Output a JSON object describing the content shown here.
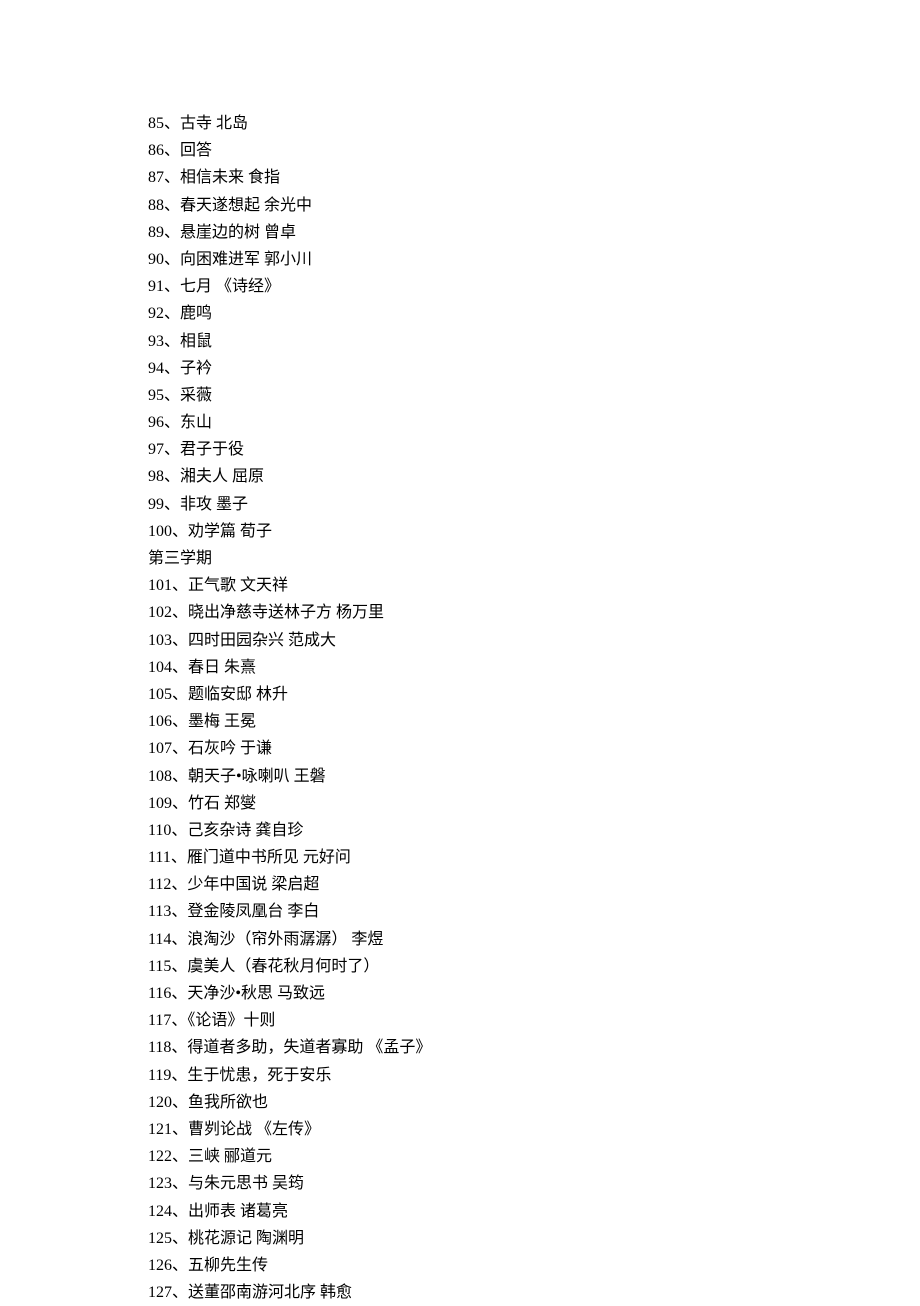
{
  "lines": [
    "85、古寺  北岛",
    "86、回答",
    "87、相信未来  食指",
    "88、春天遂想起  余光中",
    "89、悬崖边的树  曾卓",
    "90、向困难进军  郭小川",
    "91、七月  《诗经》",
    "92、鹿鸣",
    "93、相鼠",
    "94、子衿",
    "95、采薇",
    "96、东山",
    "97、君子于役",
    "98、湘夫人  屈原",
    "99、非攻  墨子",
    "100、劝学篇  荀子",
    "第三学期",
    "101、正气歌  文天祥",
    "102、晓出净慈寺送林子方  杨万里",
    "103、四时田园杂兴  范成大",
    "104、春日  朱熹",
    "105、题临安邸  林升",
    "106、墨梅  王冕",
    "107、石灰吟  于谦",
    "108、朝天子•咏喇叭  王磐",
    "109、竹石  郑燮",
    "110、己亥杂诗  龚自珍",
    "111、雁门道中书所见  元好问",
    "112、少年中国说  梁启超",
    "113、登金陵凤凰台  李白",
    "114、浪淘沙（帘外雨潺潺）  李煜",
    "115、虞美人（春花秋月何时了）",
    "116、天净沙•秋思  马致远",
    "117、《论语》十则",
    "118、得道者多助，失道者寡助  《孟子》",
    "119、生于忧患，死于安乐",
    "120、鱼我所欲也",
    "121、曹刿论战  《左传》",
    "122、三峡  郦道元",
    "123、与朱元思书  吴筠",
    "124、出师表  诸葛亮",
    "125、桃花源记  陶渊明",
    "126、五柳先生传",
    "127、送董邵南游河北序  韩愈"
  ]
}
